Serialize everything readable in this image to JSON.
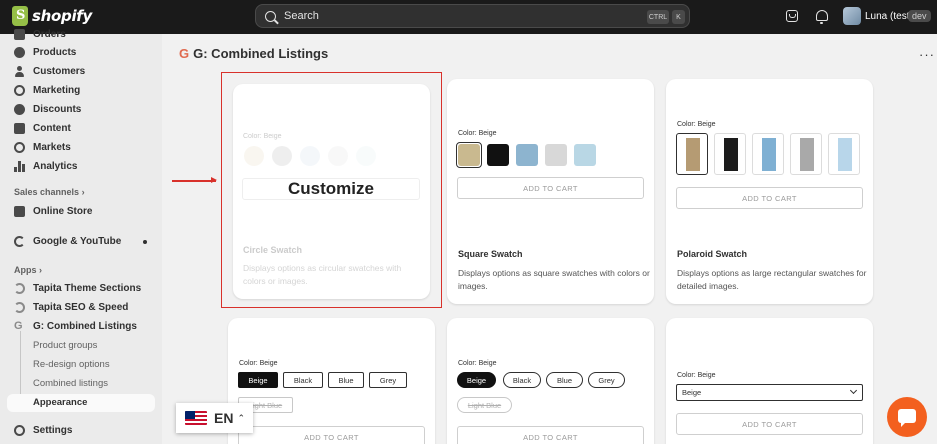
{
  "app": {
    "brand": "shopify",
    "user_name": "Luna (test)",
    "user_badge": "dev"
  },
  "search": {
    "placeholder": "Search",
    "shortcut_ctrl": "CTRL",
    "shortcut_key": "K"
  },
  "sidebar": {
    "items": [
      {
        "label": "Orders",
        "icon": "inbox-icon"
      },
      {
        "label": "Products",
        "icon": "tag-icon"
      },
      {
        "label": "Customers",
        "icon": "person-icon"
      },
      {
        "label": "Marketing",
        "icon": "target-icon"
      },
      {
        "label": "Discounts",
        "icon": "discount-icon"
      },
      {
        "label": "Content",
        "icon": "content-icon"
      },
      {
        "label": "Markets",
        "icon": "globe-icon"
      },
      {
        "label": "Analytics",
        "icon": "bar-chart-icon"
      }
    ],
    "sales_channels_label": "Sales channels",
    "online_store": "Online Store",
    "google_youtube": "Google & YouTube",
    "apps_label": "Apps",
    "apps": [
      "Tapita Theme Sections",
      "Tapita SEO & Speed",
      "G: Combined Listings"
    ],
    "sub_items": [
      "Product groups",
      "Re-design options",
      "Combined listings",
      "Appearance"
    ],
    "settings": "Settings"
  },
  "language": {
    "code": "EN"
  },
  "main": {
    "title": "G: Combined Listings",
    "title_logo": "G",
    "customize_label": "Customize",
    "color_label": "Color: Beige",
    "add_to_cart": "ADD TO CART",
    "cards": [
      {
        "title": "Circle Swatch",
        "desc": "Displays options as circular swatches with colors or images."
      },
      {
        "title": "Square Swatch",
        "desc": "Displays options as square swatches with colors or images."
      },
      {
        "title": "Polaroid Swatch",
        "desc": "Displays options as large rectangular swatches for detailed images."
      }
    ],
    "button_options": [
      "Beige",
      "Black",
      "Blue",
      "Grey",
      "Light Blue"
    ],
    "dropdown_value": "Beige",
    "swatch_colors": [
      "#e8dcc6",
      "#bfbfbf",
      "#d4e3ef",
      "#e6e6e6",
      "#e4f1f3"
    ],
    "square_colors": [
      "#c9b98f",
      "#111111",
      "#8db4cf",
      "#d8d8d8",
      "#b9d7e5"
    ],
    "pants_colors": [
      "#b59b73",
      "#1c1c1c",
      "#7fb0d3",
      "#a9a9a9",
      "#b8d6ea"
    ]
  },
  "colors": {
    "accent": "#d8312b",
    "chat": "#f3601f"
  }
}
